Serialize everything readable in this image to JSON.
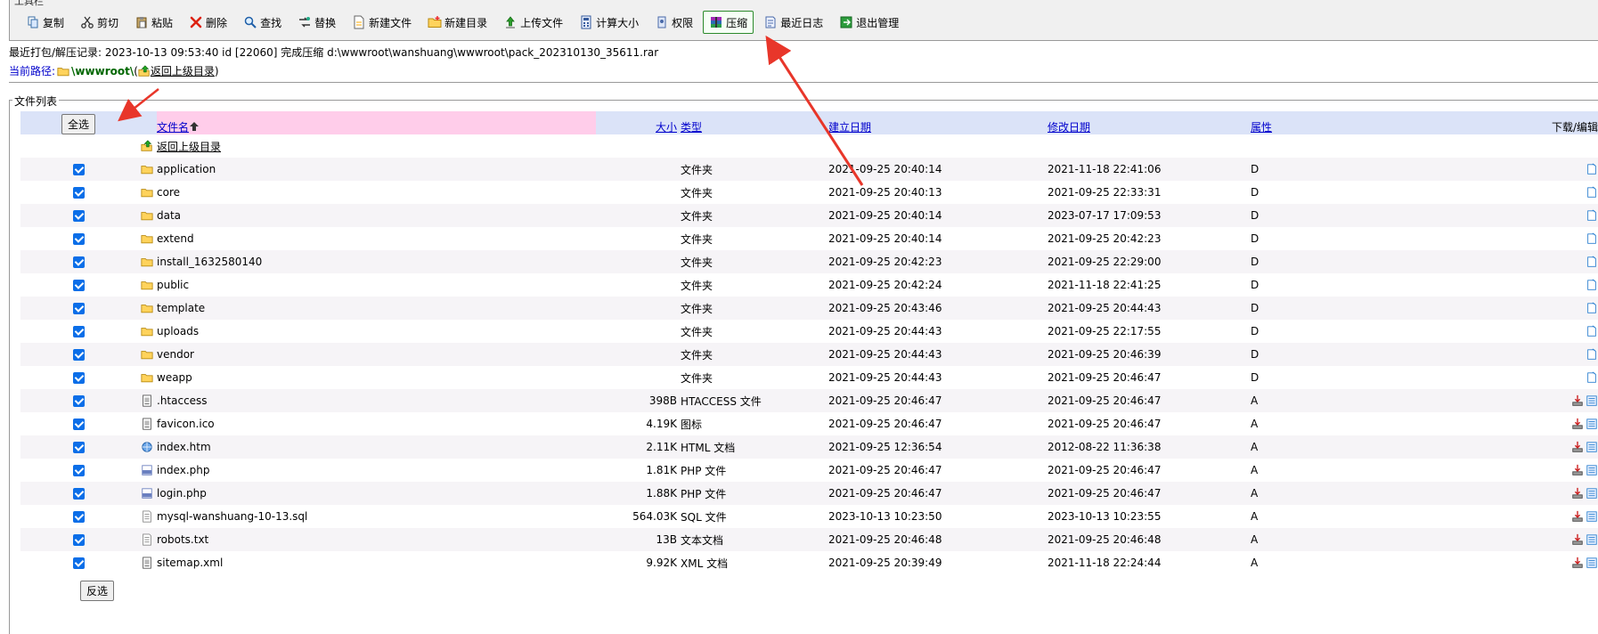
{
  "toolbar": {
    "legend": "工具栏",
    "buttons": [
      {
        "key": "copy",
        "label": "复制",
        "icon": "copy-icon"
      },
      {
        "key": "cut",
        "label": "剪切",
        "icon": "scissors-icon"
      },
      {
        "key": "paste",
        "label": "粘贴",
        "icon": "paste-icon"
      },
      {
        "key": "delete",
        "label": "删除",
        "icon": "delete-icon"
      },
      {
        "key": "find",
        "label": "查找",
        "icon": "search-icon"
      },
      {
        "key": "replace",
        "label": "替换",
        "icon": "replace-icon"
      },
      {
        "key": "new-file",
        "label": "新建文件",
        "icon": "new-file-icon"
      },
      {
        "key": "new-dir",
        "label": "新建目录",
        "icon": "new-folder-icon"
      },
      {
        "key": "upload",
        "label": "上传文件",
        "icon": "upload-icon"
      },
      {
        "key": "calc-size",
        "label": "计算大小",
        "icon": "calculator-icon"
      },
      {
        "key": "permission",
        "label": "权限",
        "icon": "permission-icon"
      },
      {
        "key": "compress",
        "label": "压缩",
        "icon": "archive-icon",
        "highlight": true
      },
      {
        "key": "recent-log",
        "label": "最近日志",
        "icon": "log-icon"
      },
      {
        "key": "exit",
        "label": "退出管理",
        "icon": "exit-icon"
      }
    ]
  },
  "info": {
    "recent": "最近打包/解压记录: 2023-10-13 09:53:40 id [22060] 完成压缩 d:\\wwwroot\\wanshuang\\wwwroot\\pack_202310130_35611.rar",
    "path_label": "当前路径:",
    "path_name": "\\wwwroot\\",
    "path_up_open": "(",
    "path_up": "返回上级目录",
    "path_up_close": ")"
  },
  "list": {
    "legend": "文件列表",
    "select_all": "全选",
    "invert": "反选",
    "headers": {
      "name": "文件名",
      "size": "大小",
      "type": "类型",
      "created": "建立日期",
      "modified": "修改日期",
      "attr": "属性",
      "action": "下载/编辑"
    },
    "up_row": "返回上级目录",
    "rows": [
      {
        "name": "application",
        "size": "",
        "type": "文件夹",
        "created": "2021-09-25 20:40:14",
        "modified": "2021-11-18 22:41:06",
        "attr": "D",
        "kind": "folder"
      },
      {
        "name": "core",
        "size": "",
        "type": "文件夹",
        "created": "2021-09-25 20:40:13",
        "modified": "2021-09-25 22:33:31",
        "attr": "D",
        "kind": "folder"
      },
      {
        "name": "data",
        "size": "",
        "type": "文件夹",
        "created": "2021-09-25 20:40:14",
        "modified": "2023-07-17 17:09:53",
        "attr": "D",
        "kind": "folder"
      },
      {
        "name": "extend",
        "size": "",
        "type": "文件夹",
        "created": "2021-09-25 20:40:14",
        "modified": "2021-09-25 20:42:23",
        "attr": "D",
        "kind": "folder"
      },
      {
        "name": "install_1632580140",
        "size": "",
        "type": "文件夹",
        "created": "2021-09-25 20:42:23",
        "modified": "2021-09-25 22:29:00",
        "attr": "D",
        "kind": "folder"
      },
      {
        "name": "public",
        "size": "",
        "type": "文件夹",
        "created": "2021-09-25 20:42:24",
        "modified": "2021-11-18 22:41:25",
        "attr": "D",
        "kind": "folder"
      },
      {
        "name": "template",
        "size": "",
        "type": "文件夹",
        "created": "2021-09-25 20:43:46",
        "modified": "2021-09-25 20:44:43",
        "attr": "D",
        "kind": "folder"
      },
      {
        "name": "uploads",
        "size": "",
        "type": "文件夹",
        "created": "2021-09-25 20:44:43",
        "modified": "2021-09-25 22:17:55",
        "attr": "D",
        "kind": "folder"
      },
      {
        "name": "vendor",
        "size": "",
        "type": "文件夹",
        "created": "2021-09-25 20:44:43",
        "modified": "2021-09-25 20:46:39",
        "attr": "D",
        "kind": "folder"
      },
      {
        "name": "weapp",
        "size": "",
        "type": "文件夹",
        "created": "2021-09-25 20:44:43",
        "modified": "2021-09-25 20:46:47",
        "attr": "D",
        "kind": "folder"
      },
      {
        "name": ".htaccess",
        "size": "398B",
        "type": "HTACCESS 文件",
        "created": "2021-09-25 20:46:47",
        "modified": "2021-09-25 20:46:47",
        "attr": "A",
        "kind": "file"
      },
      {
        "name": "favicon.ico",
        "size": "4.19K",
        "type": "图标",
        "created": "2021-09-25 20:46:47",
        "modified": "2021-09-25 20:46:47",
        "attr": "A",
        "kind": "file"
      },
      {
        "name": "index.htm",
        "size": "2.11K",
        "type": "HTML 文档",
        "created": "2021-09-25 12:36:54",
        "modified": "2012-08-22 11:36:38",
        "attr": "A",
        "kind": "html"
      },
      {
        "name": "index.php",
        "size": "1.81K",
        "type": "PHP 文件",
        "created": "2021-09-25 20:46:47",
        "modified": "2021-09-25 20:46:47",
        "attr": "A",
        "kind": "php"
      },
      {
        "name": "login.php",
        "size": "1.88K",
        "type": "PHP 文件",
        "created": "2021-09-25 20:46:47",
        "modified": "2021-09-25 20:46:47",
        "attr": "A",
        "kind": "php"
      },
      {
        "name": "mysql-wanshuang-10-13.sql",
        "size": "564.03K",
        "type": "SQL 文件",
        "created": "2023-10-13 10:23:50",
        "modified": "2023-10-13 10:23:55",
        "attr": "A",
        "kind": "text"
      },
      {
        "name": "robots.txt",
        "size": "13B",
        "type": "文本文档",
        "created": "2021-09-25 20:46:48",
        "modified": "2021-09-25 20:46:48",
        "attr": "A",
        "kind": "text"
      },
      {
        "name": "sitemap.xml",
        "size": "9.92K",
        "type": "XML 文档",
        "created": "2021-09-25 20:39:49",
        "modified": "2021-11-18 22:24:44",
        "attr": "A",
        "kind": "file"
      }
    ]
  },
  "colors": {
    "header_bg": "#dbe3f8",
    "name_header_bg": "#ffcdea",
    "link": "#0000cc",
    "checkbox": "#0b6ee8",
    "annotation_arrow": "#e8362a"
  }
}
